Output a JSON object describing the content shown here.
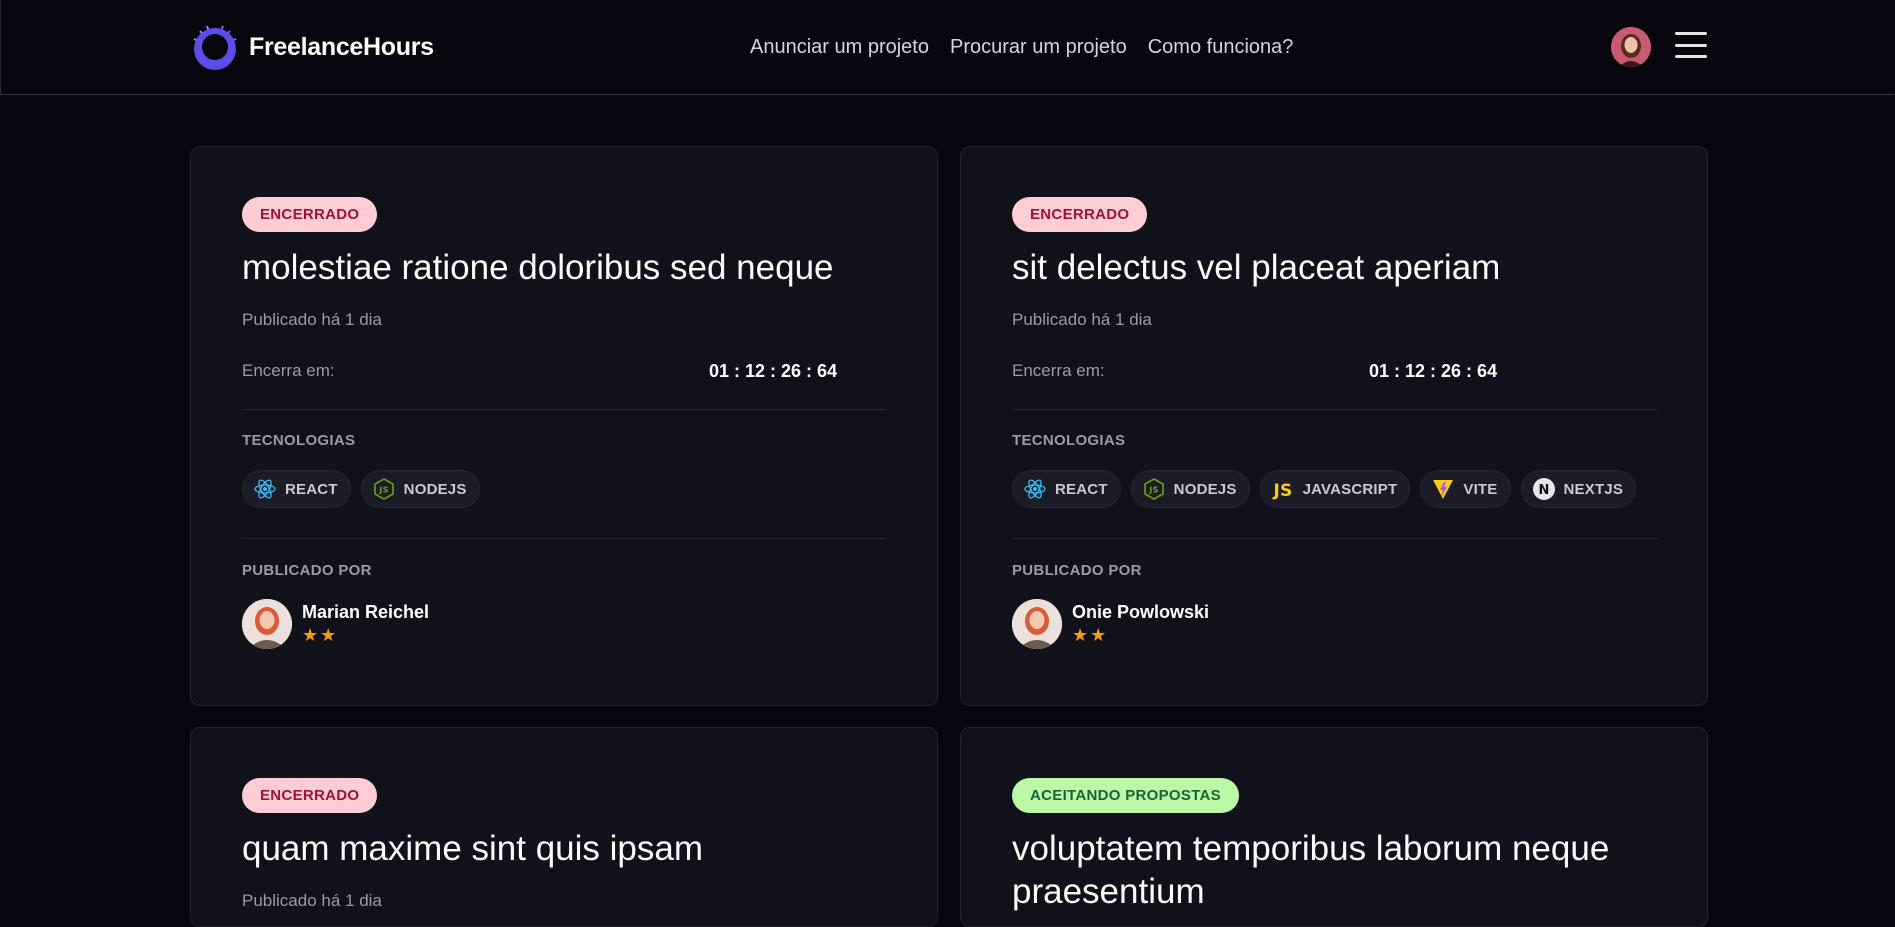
{
  "brand": {
    "name": "FreelanceHours"
  },
  "nav": {
    "items": [
      "Anunciar um projeto",
      "Procurar um projeto",
      "Como funciona?"
    ]
  },
  "labels": {
    "ends_in": "Encerra em:",
    "technologies": "TECNOLOGIAS",
    "published_by": "PUBLICADO POR"
  },
  "projects": [
    {
      "status": "ENCERRADO",
      "title": "molestiae ratione doloribus sed neque",
      "published": "Publicado há 1 dia",
      "countdown": "01 : 12 : 26 : 64",
      "tags": [
        "REACT",
        "NODEJS"
      ],
      "author": "Marian Reichel",
      "stars": "★★"
    },
    {
      "status": "ENCERRADO",
      "title": "sit delectus vel placeat aperiam",
      "published": "Publicado há 1 dia",
      "countdown": "01 : 12 : 26 : 64",
      "tags": [
        "REACT",
        "NODEJS",
        "JAVASCRIPT",
        "VITE",
        "NEXTJS"
      ],
      "author": "Onie Powlowski",
      "stars": "★★"
    },
    {
      "status": "ENCERRADO",
      "title": "quam maxime sint quis ipsam",
      "published": "Publicado há 1 dia"
    },
    {
      "status": "ACEITANDO PROPOSTAS",
      "title": "voluptatem temporibus laborum neque praesentium"
    }
  ],
  "colors": {
    "background": "#07060f",
    "card": "#11111b",
    "badge_closed_bg": "#fecdd3",
    "badge_closed_fg": "#9f1239",
    "badge_open_bg": "#bbf7a7",
    "badge_open_fg": "#166534",
    "star": "#f59e0b"
  },
  "icons": {
    "react": "react-icon",
    "nodejs": "nodejs-icon",
    "javascript": "javascript-icon",
    "vite": "vite-icon",
    "nextjs": "nextjs-icon"
  }
}
